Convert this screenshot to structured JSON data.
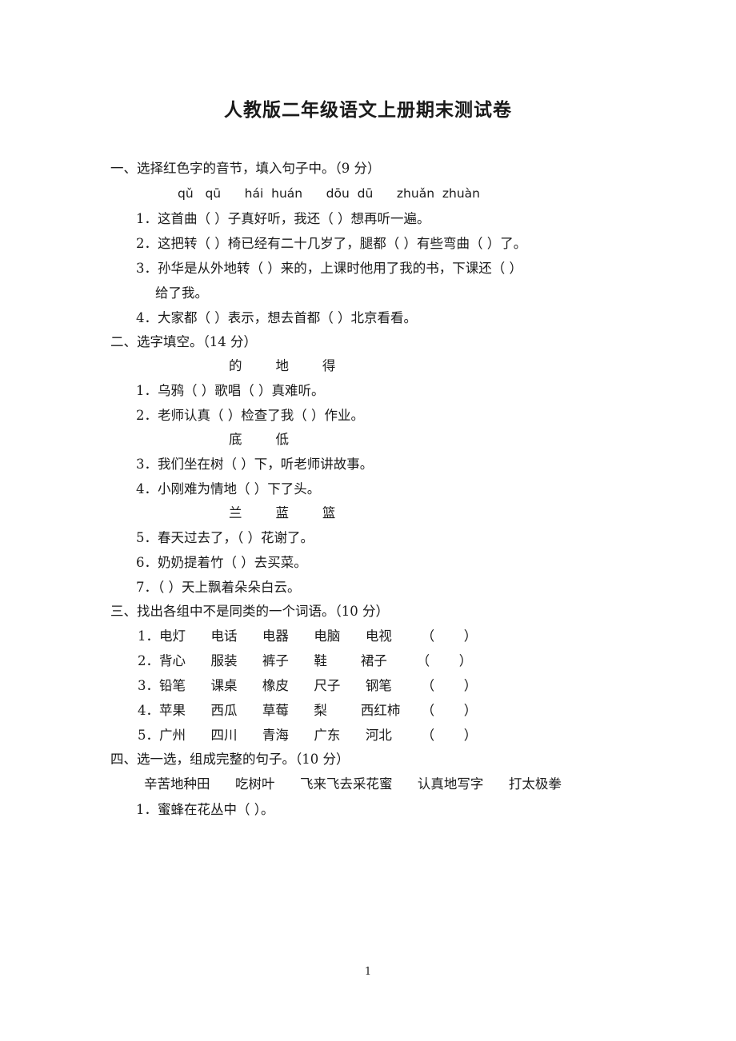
{
  "document": {
    "title": "人教版二年级语文上册期末测试卷",
    "page_number": "1"
  },
  "sections": [
    {
      "heading": "一、选择红色字的音节，填入句子中。（9 分）",
      "pinyin_row": "qǔ   qū      hái  huán      dōu  dū      zhuǎn  zhuàn",
      "questions": [
        "1．这首曲（      ）子真好听，我还（      ）想再听一遍。",
        "2．这把转（    ）椅已经有二十几岁了，腿都（    ）有些弯曲（    ）了。",
        "3．孙华是从外地转（      ）来的，上课时他用了我的书，下课还（     ）",
        "4．大家都（    ）表示，想去首都（    ）北京看看。"
      ],
      "continuation": "给了我。"
    },
    {
      "heading": "二、选字填空。（14 分）",
      "choice_rows": [
        "的        地        得",
        "底        低",
        "兰        蓝        篮"
      ],
      "questions": [
        "1．乌鸦（    ）歌唱（    ）真难听。",
        "2．老师认真（    ）检查了我（    ）作业。",
        "3．我们坐在树（    ）下，听老师讲故事。",
        "4．小刚难为情地（    ）下了头。",
        "5．春天过去了，（    ）花谢了。",
        "6．奶奶提着竹（    ）去买菜。",
        "7．（    ）天上飘着朵朵白云。"
      ]
    },
    {
      "heading": "三、找出各组中不是同类的一个词语。（10 分）",
      "groups": [
        "1．电灯      电话      电器      电脑      电视       （       ）",
        "2．背心      服装      裤子      鞋        裙子       （       ）",
        "3．铅笔      课桌      橡皮      尺子      钢笔       （       ）",
        "4．苹果      西瓜      草莓      梨        西红柿     （       ）",
        "5．广州      四川      青海      广东      河北       （       ）"
      ]
    },
    {
      "heading": "四、选一选，组成完整的句子。（10 分）",
      "word_bank": "辛苦地种田      吃树叶      飞来飞去采花蜜      认真地写字      打太极拳",
      "questions": [
        "1．蜜蜂在花丛中（                    ）。"
      ]
    }
  ]
}
